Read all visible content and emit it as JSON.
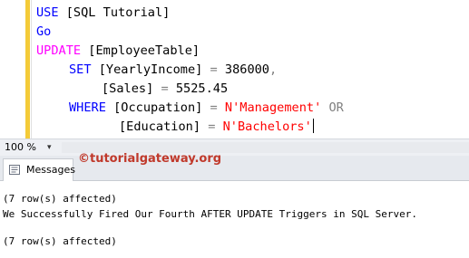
{
  "editor": {
    "lines": [
      {
        "tokens": [
          {
            "t": "USE ",
            "c": "kw"
          },
          {
            "t": "[SQL Tutorial]",
            "c": ""
          }
        ]
      },
      {
        "tokens": [
          {
            "t": "Go",
            "c": "kw"
          }
        ]
      },
      {
        "tokens": [
          {
            "t": "UPDATE ",
            "c": "kw2"
          },
          {
            "t": "[EmployeeTable]",
            "c": ""
          }
        ]
      },
      {
        "tokens": [
          {
            "t": "SET ",
            "c": "kw"
          },
          {
            "t": "[YearlyIncome] ",
            "c": ""
          },
          {
            "t": "= ",
            "c": "op"
          },
          {
            "t": "386000",
            "c": ""
          },
          {
            "t": ",",
            "c": "op"
          }
        ]
      },
      {
        "tokens": [
          {
            "t": "[Sales] ",
            "c": ""
          },
          {
            "t": "= ",
            "c": "op"
          },
          {
            "t": "5525.45",
            "c": ""
          }
        ]
      },
      {
        "tokens": [
          {
            "t": "WHERE ",
            "c": "kw"
          },
          {
            "t": "[Occupation] ",
            "c": ""
          },
          {
            "t": "= ",
            "c": "op"
          },
          {
            "t": "N'Management'",
            "c": "str"
          },
          {
            "t": " OR",
            "c": "op"
          }
        ]
      },
      {
        "tokens": [
          {
            "t": "[Education] ",
            "c": ""
          },
          {
            "t": "= ",
            "c": "op"
          },
          {
            "t": "N'Bachelors'",
            "c": "str"
          }
        ]
      }
    ]
  },
  "statusbar": {
    "zoom": "100 %",
    "zoom_arrow": "▾"
  },
  "results": {
    "tab_label": "Messages",
    "tab_icon": "messages-icon"
  },
  "watermark": "©tutorialgateway.org",
  "messages": {
    "line1": "(7 row(s) affected)",
    "line2": "We Successfully Fired Our Fourth AFTER UPDATE Triggers in SQL Server.",
    "line3": "(7 row(s) affected)"
  }
}
